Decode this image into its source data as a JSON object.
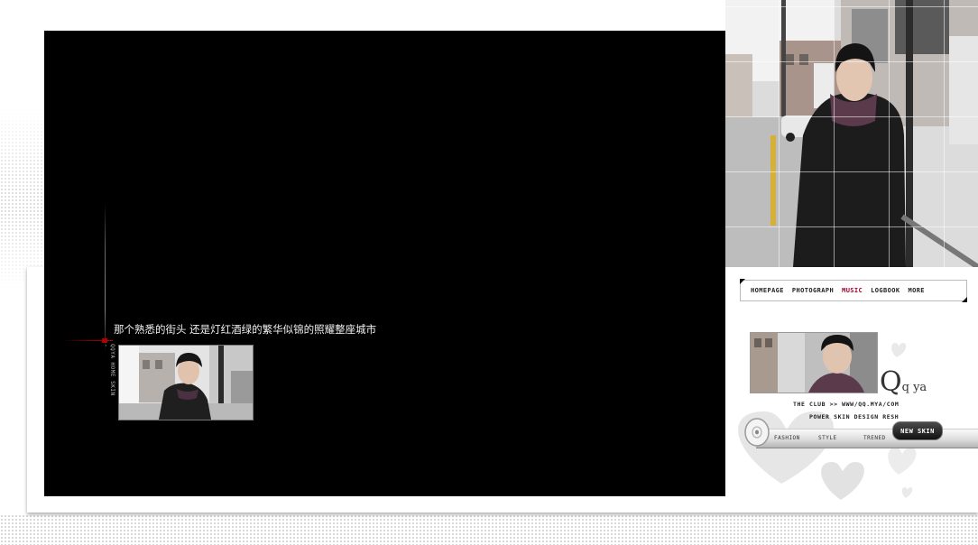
{
  "player": {
    "caption": "那个熟悉的街头 还是灯红酒绿的繁华似锦的照耀整座城市",
    "vertical_label": "QQYA HOME SKIN -"
  },
  "nav": {
    "items": [
      {
        "label": "HOMEPAGE",
        "active": false
      },
      {
        "label": "PHOTOGRAPH",
        "active": false
      },
      {
        "label": "MUSIC",
        "active": true
      },
      {
        "label": "LOGBOOK",
        "active": false
      },
      {
        "label": "MORE",
        "active": false
      }
    ]
  },
  "profile": {
    "brand_big": "Q",
    "brand_small": "q ya",
    "club_line": "THE CLUB >> WWW/QQ.MYA/COM",
    "tagline": "POWER SKIN DESIGN RESH"
  },
  "bottom_bar": {
    "items": [
      "FASHION",
      "STYLE",
      "TRENED"
    ],
    "new_skin": "NEW SKIN"
  },
  "colors": {
    "player_bg": "#000000",
    "accent_red": "#a0002a",
    "page_bg": "#ffffff"
  },
  "icons": {
    "disc": "cd-disc-icon",
    "hearts": "heart-icon",
    "bullet": "grid-dots-icon"
  }
}
